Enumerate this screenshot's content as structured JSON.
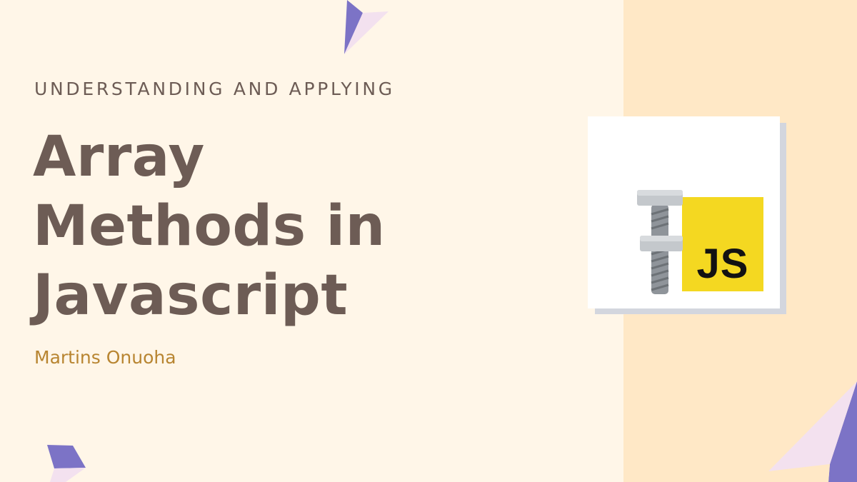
{
  "slide": {
    "kicker": "UNDERSTANDING AND APPLYING",
    "title_lines": [
      "Array",
      "Methods in",
      "Javascript"
    ],
    "author": "Martins Onuoha"
  },
  "logo": {
    "text": "JS",
    "icon": "bolt-and-nut-icon"
  },
  "colors": {
    "background": "#fff6e8",
    "side_panel": "#ffe8c6",
    "title": "#6d5c55",
    "author": "#b88531",
    "js_yellow": "#f4d821",
    "accent_purple": "#7c73c6",
    "accent_pink": "#f3e1ef"
  }
}
